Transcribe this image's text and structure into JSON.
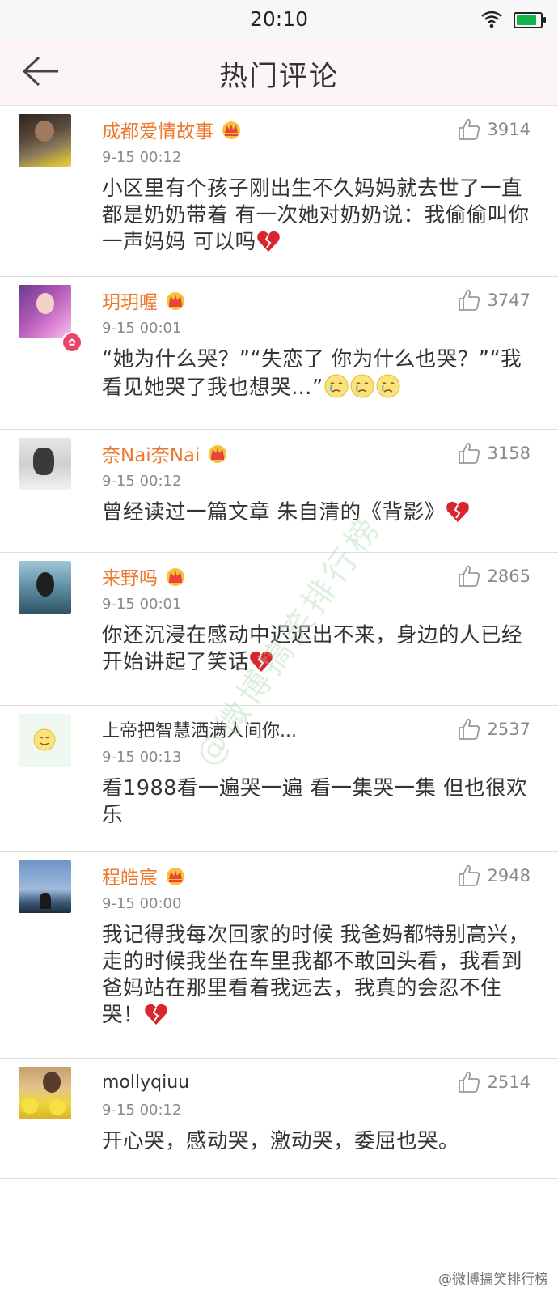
{
  "status_bar": {
    "time": "20:10"
  },
  "nav": {
    "title": "热门评论"
  },
  "comments": [
    {
      "name": "成都爱情故事",
      "verified_crown": true,
      "time": "9-15 00:12",
      "likes": "3914",
      "text": "小区里有个孩子刚出生不久妈妈就去世了一直都是奶奶带着 有一次她对奶奶说：我偷偷叫你一声妈妈 可以吗",
      "trailing_icon": "broken-heart"
    },
    {
      "name": "玥玥喔",
      "verified_crown": true,
      "time": "9-15 00:01",
      "likes": "3747",
      "text": "“她为什么哭？”“失恋了 你为什么也哭？”“我看见她哭了我也想哭…”",
      "trailing_icon": "crying-face x3"
    },
    {
      "name": "奈Nai奈Nai",
      "verified_crown": true,
      "time": "9-15 00:12",
      "likes": "3158",
      "text": "曾经读过一篇文章 朱自清的《背影》",
      "trailing_icon": "broken-heart"
    },
    {
      "name": "来野吗",
      "verified_crown": true,
      "time": "9-15 00:01",
      "likes": "2865",
      "text": "你还沉浸在感动中迟迟出不来，身边的人已经开始讲起了笑话",
      "trailing_icon": "broken-heart"
    },
    {
      "name": "上帝把智慧洒满人间你...",
      "verified_crown": false,
      "time": "9-15 00:13",
      "likes": "2537",
      "text": "看1988看一遍哭一遍 看一集哭一集 但也很欢乐",
      "trailing_icon": ""
    },
    {
      "name": "程皓宸",
      "verified_crown": true,
      "time": "9-15 00:00",
      "likes": "2948",
      "text": "我记得我每次回家的时候 我爸妈都特别高兴，走的时候我坐在车里我都不敢回头看，我看到爸妈站在那里看着我远去，我真的会忍不住哭！",
      "trailing_icon": "broken-heart"
    },
    {
      "name": "mollyqiuu",
      "verified_crown": false,
      "time": "9-15 00:12",
      "likes": "2514",
      "text": "开心哭，感动哭，激动哭，委屈也哭。",
      "trailing_icon": ""
    }
  ],
  "watermark": "@微博搞笑排行榜",
  "footer_watermark": "@微博搞笑排行榜"
}
